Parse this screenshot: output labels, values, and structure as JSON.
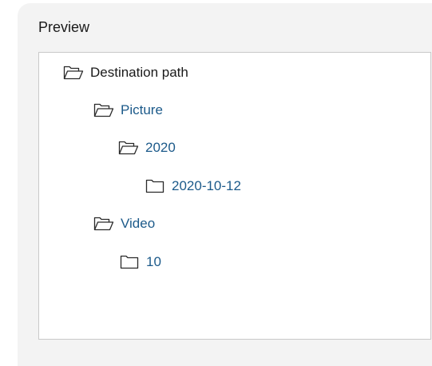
{
  "panel": {
    "title": "Preview"
  },
  "tree": {
    "root": {
      "label": "Destination path",
      "icon": "folder-open-icon"
    },
    "picture": {
      "label": "Picture",
      "icon": "folder-open-icon"
    },
    "year": {
      "label": "2020",
      "icon": "folder-open-icon"
    },
    "date": {
      "label": "2020-10-12",
      "icon": "folder-closed-icon"
    },
    "video": {
      "label": "Video",
      "icon": "folder-open-icon"
    },
    "month": {
      "label": "10",
      "icon": "folder-closed-icon"
    }
  },
  "colors": {
    "panel_bg": "#f3f3f3",
    "root_text": "#1a1a1a",
    "child_text": "#1c5a8a",
    "icon_stroke": "#2a2a2a"
  }
}
